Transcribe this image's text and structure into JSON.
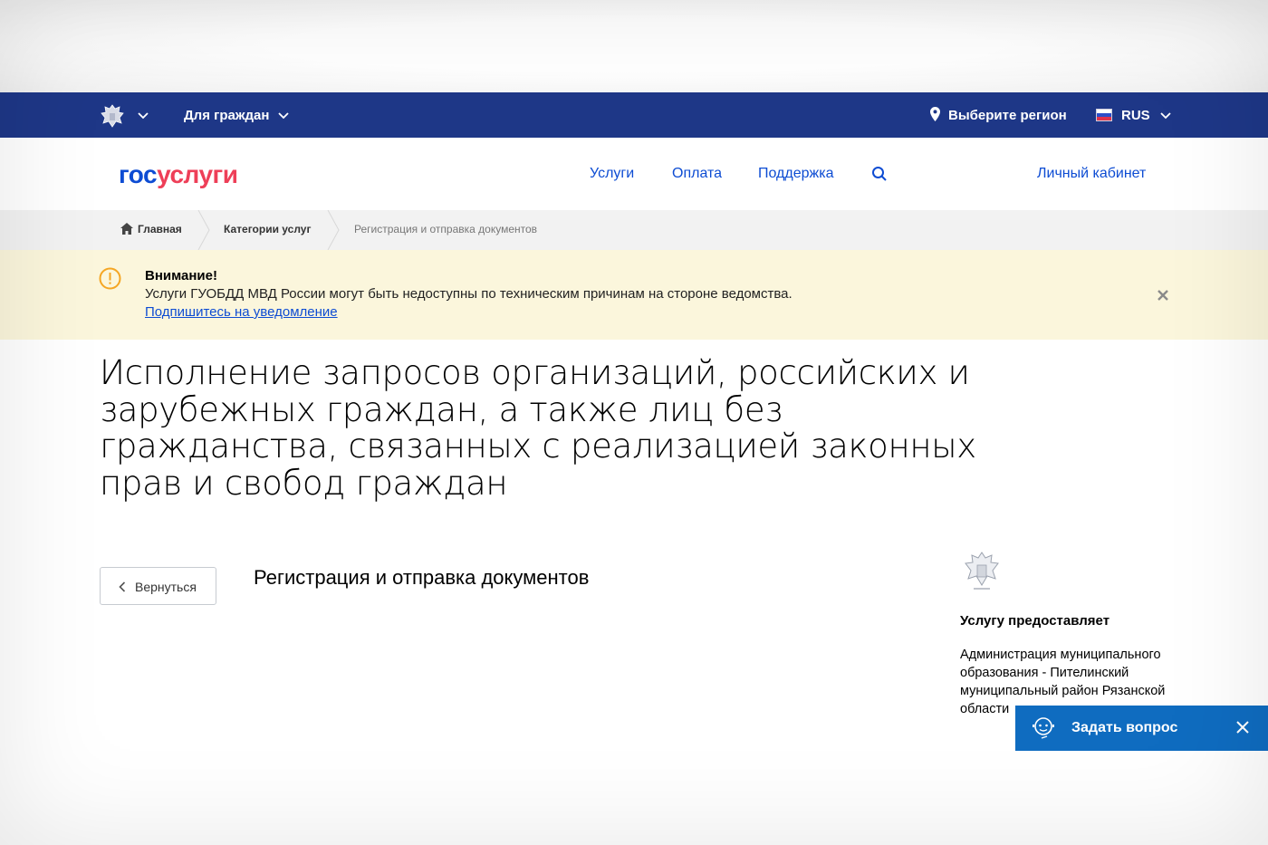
{
  "topbar": {
    "for_citizens": "Для граждан",
    "region": "Выберите регион",
    "language": "RUS"
  },
  "header": {
    "logo_part1": "гос",
    "logo_part2": "услуги",
    "nav": [
      "Услуги",
      "Оплата",
      "Поддержка"
    ],
    "cabinet": "Личный кабинет"
  },
  "breadcrumbs": [
    "Главная",
    "Категории услуг",
    "Регистрация и отправка документов"
  ],
  "alert": {
    "title": "Внимание!",
    "text": "Услуги ГУОБДД МВД России могут быть недоступны по техническим причинам на стороне ведомства.",
    "link": "Подпишитесь на уведомление"
  },
  "main": {
    "title": "Исполнение запросов организаций, российских и зарубежных граждан, а также лиц без гражданства, связанных с реализацией законных прав и свобод граждан",
    "back": "Вернуться",
    "service_name": "Регистрация и отправка документов"
  },
  "provider": {
    "heading": "Услугу предоставляет",
    "name": "Администрация муниципального образования - Пителинский муниципальный район Рязанской области"
  },
  "ask": {
    "label": "Задать вопрос"
  },
  "colors": {
    "topbar": "#1e3787",
    "link": "#0d4cd3",
    "logo_accent": "#ee3f58",
    "alert_bg": "#fbf6dc",
    "warning": "#f5a623",
    "ask_bg": "#0f6cc0"
  }
}
